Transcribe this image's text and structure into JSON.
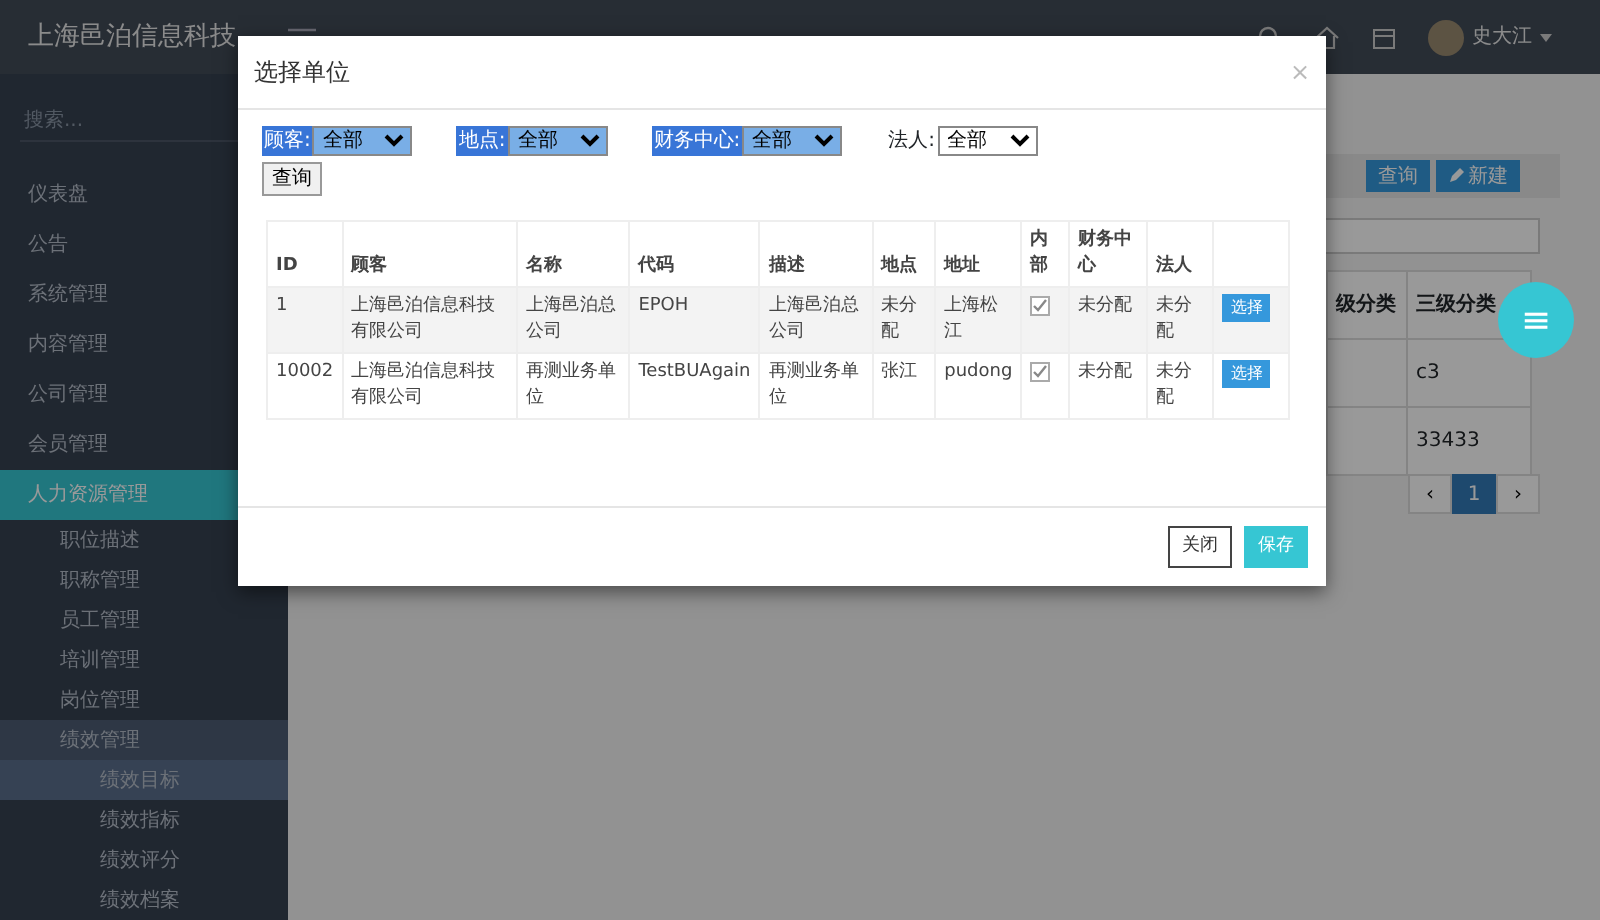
{
  "app": {
    "title": "上海邑泊信息科技"
  },
  "header": {
    "user": "史大江"
  },
  "sidebar": {
    "search_placeholder": "搜索...",
    "items": [
      {
        "label": "仪表盘",
        "selected": false
      },
      {
        "label": "公告",
        "selected": false
      },
      {
        "label": "系统管理",
        "selected": false
      },
      {
        "label": "内容管理",
        "selected": false
      },
      {
        "label": "公司管理",
        "selected": false
      },
      {
        "label": "会员管理",
        "selected": false
      },
      {
        "label": "人力资源管理",
        "selected": true,
        "children": [
          {
            "label": "职位描述",
            "selected": false
          },
          {
            "label": "职称管理",
            "selected": false
          },
          {
            "label": "员工管理",
            "selected": false
          },
          {
            "label": "培训管理",
            "selected": false
          },
          {
            "label": "岗位管理",
            "selected": false
          },
          {
            "label": "绩效管理",
            "selected": true,
            "children": [
              {
                "label": "绩效目标",
                "selected": true
              },
              {
                "label": "绩效指标",
                "selected": false
              },
              {
                "label": "绩效评分",
                "selected": false
              },
              {
                "label": "绩效档案",
                "selected": false
              }
            ]
          }
        ]
      }
    ]
  },
  "toolbar": {
    "buttons": [
      {
        "label": "查询",
        "kind": "plain"
      },
      {
        "label": "新建",
        "kind": "new"
      }
    ]
  },
  "table": {
    "columns": [
      "级分类",
      "三级分类"
    ],
    "rows": [
      {
        "column_2": "c3"
      },
      {
        "column_2": "33433"
      }
    ]
  },
  "pagination": {
    "prev": "‹",
    "pages": [
      {
        "label": "1",
        "selected": true
      }
    ],
    "next": "›"
  },
  "fab": {
    "label": "≡"
  },
  "modal": {
    "title": "选择单位",
    "close": "×",
    "filters": [
      {
        "label": "顾客:",
        "value": "全部",
        "highlighted": true
      },
      {
        "label": "地点:",
        "value": "全部",
        "highlighted": true
      },
      {
        "label": "财务中心:",
        "value": "全部",
        "highlighted": true
      },
      {
        "label": "法人:",
        "value": "全部",
        "highlighted": false
      }
    ],
    "query_button": "查询",
    "columns": [
      "ID",
      "顾客",
      "名称",
      "代码",
      "描述",
      "地点",
      "地址",
      "内部",
      "财务中心",
      "法人"
    ],
    "rows": [
      {
        "id": "1",
        "customer": "上海邑泊信息科技有限公司",
        "name": "上海邑泊总公司",
        "code": "EPOH",
        "description": "上海邑泊总公司",
        "location": "未分配",
        "address": "上海松江",
        "internal": true,
        "finance_center": "未分配",
        "legal_person": "未分配",
        "action": "选择"
      },
      {
        "id": "10002",
        "customer": "上海邑泊信息科技有限公司",
        "name": "再测业务单位",
        "code": "TestBUAgain",
        "description": "再测业务单位",
        "location": "张江",
        "address": "pudong",
        "internal": true,
        "finance_center": "未分配",
        "legal_person": "未分配",
        "action": "选择"
      }
    ],
    "buttons": [
      {
        "label": "关闭",
        "kind": "default"
      },
      {
        "label": "保存",
        "kind": "primary"
      }
    ]
  }
}
